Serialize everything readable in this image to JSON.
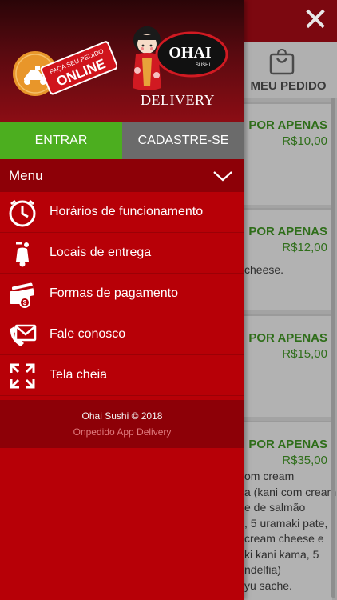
{
  "background": {
    "close_icon": "close-icon",
    "order_tab": {
      "icon": "shopping-bag-icon",
      "label": "MEU PEDIDO"
    },
    "cards": [
      {
        "price_title": "POR APENAS",
        "price": "R$10,00",
        "desc": []
      },
      {
        "price_title": "POR APENAS",
        "price": "R$12,00",
        "desc": [
          "cheese."
        ]
      },
      {
        "price_title": "POR APENAS",
        "price": "R$15,00",
        "desc": []
      },
      {
        "price_title": "POR APENAS",
        "price": "R$35,00",
        "desc": [
          "om cream",
          "a (kani com cream",
          "e de salmão",
          ", 5 uramaki pate,",
          "cream cheese e",
          "ki kani kama, 5",
          "ndelfia)",
          "yu sache."
        ]
      }
    ]
  },
  "drawer": {
    "header": {
      "badge_text_small": "FAÇA SEU PEDIDO",
      "badge_text_big": "ONLINE",
      "logo_text": "OHAI",
      "logo_sub": "SUSHI",
      "delivery_label": "DELIVERY"
    },
    "auth": {
      "login_label": "ENTRAR",
      "signup_label": "CADASTRE-SE"
    },
    "menu": {
      "title": "Menu",
      "items": [
        {
          "label": "Horários de funcionamento",
          "icon": "clock-icon"
        },
        {
          "label": "Locais de entrega",
          "icon": "scooter-icon"
        },
        {
          "label": "Formas de pagamento",
          "icon": "payment-card-icon"
        },
        {
          "label": "Fale conosco",
          "icon": "mail-phone-icon"
        },
        {
          "label": "Tela cheia",
          "icon": "fullscreen-icon"
        }
      ]
    },
    "footer": {
      "copyright": "Ohai Sushi © 2018",
      "subtitle": "Onpedido App Delivery"
    }
  },
  "colors": {
    "drawer_red": "#b70007",
    "dark_red": "#8d0007",
    "login_green": "#4cae1f",
    "signup_gray": "#6b6b6b",
    "price_green": "#2f6e1a"
  }
}
